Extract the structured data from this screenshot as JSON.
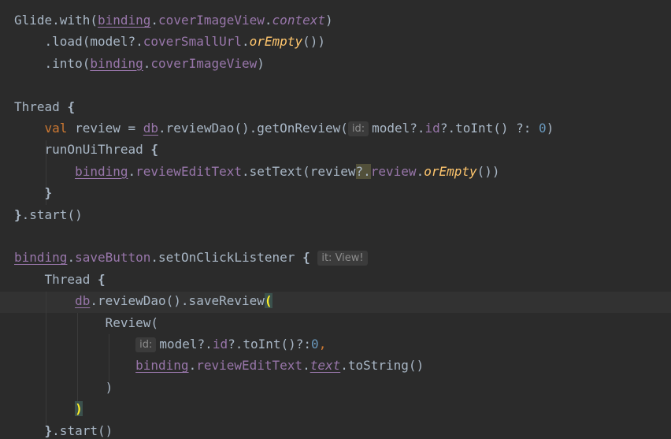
{
  "editor": {
    "lines": [
      {
        "tokens": [
          {
            "t": "Glide.with(",
            "c": "plain"
          },
          {
            "t": "binding",
            "c": "ref"
          },
          {
            "t": ".",
            "c": "plain"
          },
          {
            "t": "coverImageView",
            "c": "field"
          },
          {
            "t": ".",
            "c": "plain"
          },
          {
            "t": "context",
            "c": "prop-italic"
          },
          {
            "t": ")",
            "c": "plain"
          }
        ]
      },
      {
        "tokens": [
          {
            "t": "    .load(model?.",
            "c": "plain"
          },
          {
            "t": "coverSmallUrl",
            "c": "field"
          },
          {
            "t": ".",
            "c": "plain"
          },
          {
            "t": "orEmpty",
            "c": "fn-italic"
          },
          {
            "t": "())",
            "c": "plain"
          }
        ]
      },
      {
        "tokens": [
          {
            "t": "    .into(",
            "c": "plain"
          },
          {
            "t": "binding",
            "c": "ref"
          },
          {
            "t": ".",
            "c": "plain"
          },
          {
            "t": "coverImageView",
            "c": "field"
          },
          {
            "t": ")",
            "c": "plain"
          }
        ]
      },
      {
        "tokens": []
      },
      {
        "tokens": [
          {
            "t": "Thread ",
            "c": "plain"
          },
          {
            "t": "{",
            "c": "bold"
          }
        ]
      },
      {
        "tokens": [
          {
            "t": "    ",
            "c": "plain"
          },
          {
            "t": "val",
            "c": "kw"
          },
          {
            "t": " review = ",
            "c": "plain"
          },
          {
            "t": "db",
            "c": "ref"
          },
          {
            "t": ".reviewDao().getOnReview(",
            "c": "plain"
          },
          {
            "t": "id:",
            "c": "hint"
          },
          {
            "t": "model?.",
            "c": "plain"
          },
          {
            "t": "id",
            "c": "field"
          },
          {
            "t": "?.toInt() ?: ",
            "c": "plain"
          },
          {
            "t": "0",
            "c": "num"
          },
          {
            "t": ")",
            "c": "plain"
          }
        ]
      },
      {
        "tokens": [
          {
            "t": "    runOnUiThread ",
            "c": "plain"
          },
          {
            "t": "{",
            "c": "bold"
          }
        ]
      },
      {
        "tokens": [
          {
            "t": "        ",
            "c": "plain"
          },
          {
            "t": "binding",
            "c": "ref"
          },
          {
            "t": ".",
            "c": "plain"
          },
          {
            "t": "reviewEditText",
            "c": "field"
          },
          {
            "t": ".setText(review",
            "c": "plain"
          },
          {
            "t": "?.",
            "c": "usage-hl"
          },
          {
            "t": "review",
            "c": "field"
          },
          {
            "t": ".",
            "c": "plain"
          },
          {
            "t": "orEmpty",
            "c": "fn-italic"
          },
          {
            "t": "())",
            "c": "plain"
          }
        ]
      },
      {
        "tokens": [
          {
            "t": "    ",
            "c": "plain"
          },
          {
            "t": "}",
            "c": "bold"
          }
        ]
      },
      {
        "tokens": [
          {
            "t": "}",
            "c": "bold"
          },
          {
            "t": ".start()",
            "c": "plain"
          }
        ]
      },
      {
        "tokens": []
      },
      {
        "tokens": [
          {
            "t": "binding",
            "c": "ref"
          },
          {
            "t": ".",
            "c": "plain"
          },
          {
            "t": "saveButton",
            "c": "field"
          },
          {
            "t": ".setOnClickListener ",
            "c": "plain"
          },
          {
            "t": "{",
            "c": "bold"
          },
          {
            "t": " ",
            "c": "plain"
          },
          {
            "t": "it: View!",
            "c": "hint"
          }
        ]
      },
      {
        "tokens": [
          {
            "t": "    Thread ",
            "c": "plain"
          },
          {
            "t": "{",
            "c": "bold"
          }
        ]
      },
      {
        "tokens": [
          {
            "t": "        ",
            "c": "plain"
          },
          {
            "t": "db",
            "c": "ref"
          },
          {
            "t": ".reviewDao().saveReview",
            "c": "plain"
          },
          {
            "t": "(",
            "c": "brace-match"
          }
        ]
      },
      {
        "tokens": [
          {
            "t": "            Review(",
            "c": "plain"
          }
        ]
      },
      {
        "tokens": [
          {
            "t": "                ",
            "c": "plain"
          },
          {
            "t": "id:",
            "c": "hint"
          },
          {
            "t": "model?.",
            "c": "plain"
          },
          {
            "t": "id",
            "c": "field"
          },
          {
            "t": "?.toInt()?:",
            "c": "plain"
          },
          {
            "t": "0",
            "c": "num"
          },
          {
            "t": ",",
            "c": "kw"
          }
        ]
      },
      {
        "tokens": [
          {
            "t": "                ",
            "c": "plain"
          },
          {
            "t": "binding",
            "c": "ref"
          },
          {
            "t": ".",
            "c": "plain"
          },
          {
            "t": "reviewEditText",
            "c": "field"
          },
          {
            "t": ".",
            "c": "plain"
          },
          {
            "t": "text",
            "c": "prop-italic-u"
          },
          {
            "t": ".toString()",
            "c": "plain"
          }
        ]
      },
      {
        "tokens": [
          {
            "t": "            )",
            "c": "plain"
          }
        ]
      },
      {
        "tokens": [
          {
            "t": "        ",
            "c": "plain"
          },
          {
            "t": ")",
            "c": "brace-match"
          }
        ]
      },
      {
        "tokens": [
          {
            "t": "    ",
            "c": "plain"
          },
          {
            "t": "}",
            "c": "bold"
          },
          {
            "t": ".start()",
            "c": "plain"
          }
        ]
      }
    ]
  }
}
